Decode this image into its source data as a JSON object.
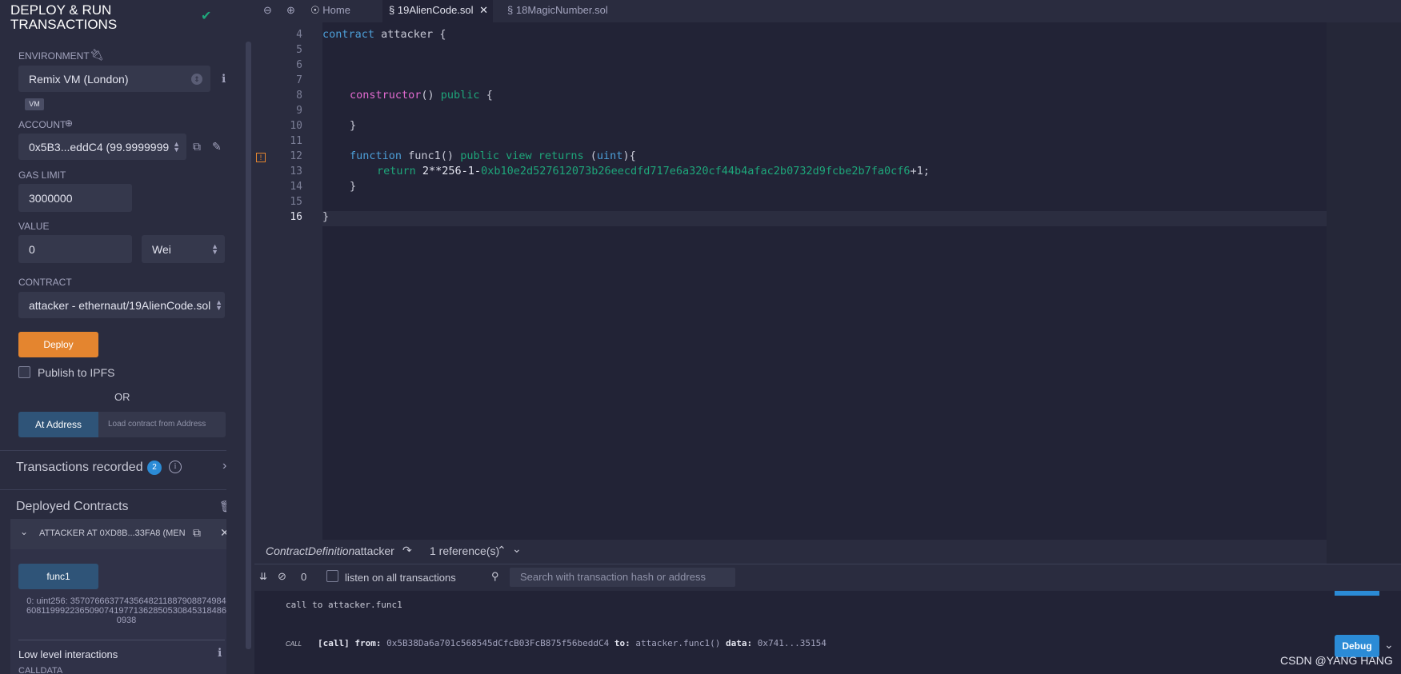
{
  "panel": {
    "title": "DEPLOY & RUN TRANSACTIONS",
    "environment": {
      "label": "ENVIRONMENT",
      "value": "Remix VM (London)",
      "badge": "VM"
    },
    "account": {
      "label": "ACCOUNT",
      "value": "0x5B3...eddC4 (99.9999999"
    },
    "gas_limit": {
      "label": "GAS LIMIT",
      "value": "3000000"
    },
    "value": {
      "label": "VALUE",
      "amount": "0",
      "unit": "Wei"
    },
    "contract": {
      "label": "CONTRACT",
      "value": "attacker - ethernaut/19AlienCode.sol"
    },
    "deploy_label": "Deploy",
    "publish_label": "Publish to IPFS",
    "or_label": "OR",
    "at_address_label": "At Address",
    "load_placeholder": "Load contract from Address",
    "transactions_recorded": {
      "label": "Transactions recorded",
      "count": "2"
    },
    "deployed": {
      "title": "Deployed Contracts",
      "instance": "ATTACKER AT 0XD8B...33FA8 (MEN",
      "func_label": "func1",
      "result": "0: uint256: 35707666377435648211887908874984608119992236509074197713628505308453184860938",
      "low_level": "Low level interactions",
      "calldata": "CALLDATA"
    }
  },
  "tabs": [
    {
      "label": "Home"
    },
    {
      "label": "19AlienCode.sol"
    },
    {
      "label": "18MagicNumber.sol"
    }
  ],
  "editor": {
    "lines": [
      "4",
      "5",
      "6",
      "7",
      "8",
      "9",
      "10",
      "11",
      "12",
      "13",
      "14",
      "15",
      "16"
    ],
    "code": {
      "l4_kw": "contract",
      "l4_name": " attacker ",
      "l4_brace": "{",
      "l8_fn": "constructor",
      "l8_rest": "() ",
      "l8_kw": "public",
      "l8_brace": " {",
      "l10": "}",
      "l12_kw": "function",
      "l12_name": " func1() ",
      "l12_pub": "public",
      "l12_view": " view ",
      "l12_ret": "returns",
      "l12_open": " (",
      "l12_type": "uint",
      "l12_close": "){",
      "l13_ret": "return",
      "l13_expr": " 2**256-1-",
      "l13_hex": "0xb10e2d527612073b26eecdfd717e6a320cf44b4afac2b0732d9fcbe2b7fa0cf6",
      "l13_end": "+1;",
      "l14": "}",
      "l16": "}"
    }
  },
  "ref_bar": {
    "kind": "ContractDefinition",
    "name": "attacker",
    "refs": "1 reference(s)"
  },
  "terminal": {
    "count": "0",
    "listen_label": "listen on all transactions",
    "search_placeholder": "Search with transaction hash or address",
    "call_msg": "call to attacker.func1",
    "call_tag": "CALL",
    "call_kind": "[call]",
    "from_label": "from:",
    "from_value": "0x5B38Da6a701c568545dCfcB03FcB875f56beddC4",
    "to_label": "to:",
    "to_value": "attacker.func1()",
    "data_label": "data:",
    "data_value": "0x741...35154",
    "debug_label": "Debug"
  },
  "watermark": "CSDN @YANG HANG"
}
